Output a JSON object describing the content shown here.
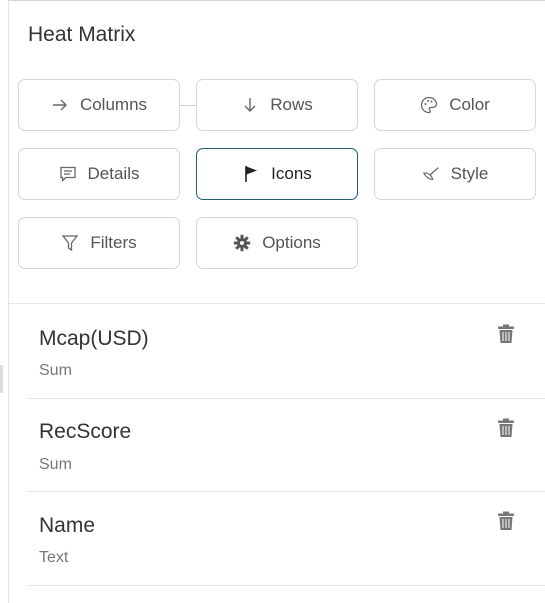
{
  "panel": {
    "title": "Heat Matrix"
  },
  "buttons": {
    "columns": "Columns",
    "rows": "Rows",
    "color": "Color",
    "details": "Details",
    "icons": "Icons",
    "style": "Style",
    "filters": "Filters",
    "options": "Options"
  },
  "active_button": "icons",
  "fields": [
    {
      "name": "Mcap(USD)",
      "aggregation": "Sum"
    },
    {
      "name": "RecScore",
      "aggregation": "Sum"
    },
    {
      "name": "Name",
      "aggregation": "Text"
    }
  ],
  "colors": {
    "accent": "#1e5f74",
    "border": "#d6d6d6",
    "text": "#333333",
    "muted": "#777777"
  }
}
